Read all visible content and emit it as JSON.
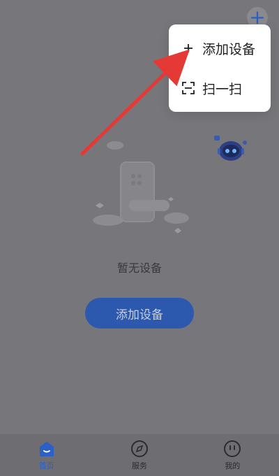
{
  "header": {
    "add_icon": "plus-icon"
  },
  "menu": {
    "items": [
      {
        "icon": "plus-icon",
        "label": "添加设备"
      },
      {
        "icon": "scan-icon",
        "label": "扫一扫"
      }
    ]
  },
  "main": {
    "empty_text": "暂无设备",
    "add_button_label": "添加设备"
  },
  "tabbar": {
    "tabs": [
      {
        "label": "首页",
        "icon": "home-icon",
        "active": true
      },
      {
        "label": "服务",
        "icon": "compass-icon",
        "active": false
      },
      {
        "label": "我的",
        "icon": "profile-icon",
        "active": false
      }
    ]
  },
  "colors": {
    "accent": "#2c5fc7",
    "button": "#2c58ad",
    "arrow": "#e53935",
    "overlay": "#77777b"
  }
}
